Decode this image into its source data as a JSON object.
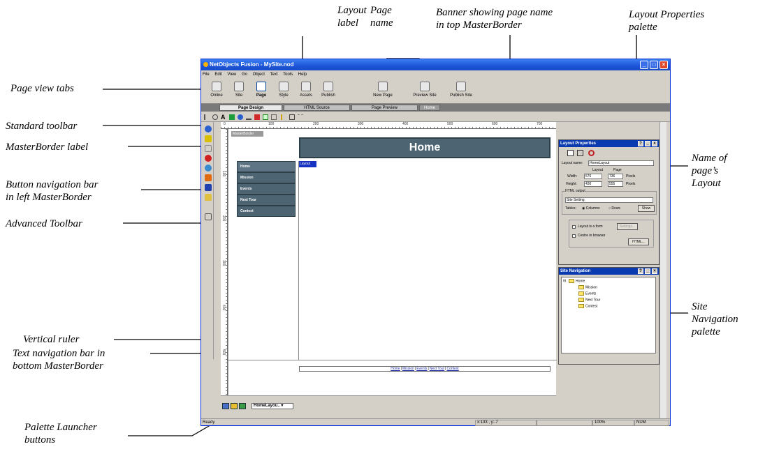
{
  "callouts": {
    "layout_label": "Layout\nlabel",
    "page_name": "Page\nname",
    "banner": "Banner showing page name\nin top MasterBorder",
    "layout_props": "Layout Properties\npalette",
    "page_view_tabs": "Page view tabs",
    "standard_toolbar": "Standard toolbar",
    "masterborder_label": "MasterBorder label",
    "button_nav": "Button navigation bar\nin left MasterBorder",
    "advanced_toolbar": "Advanced Toolbar",
    "layout_name": "Name of\npage’s\nLayout",
    "site_nav": "Site\nNavigation\npalette",
    "vertical_ruler": "Vertical ruler",
    "text_nav": "Text navigation bar in\nbottom MasterBorder",
    "palette_launcher": "Palette Launcher\nbuttons"
  },
  "window": {
    "title": "NetObjects Fusion - MySite.nod",
    "menu": [
      "File",
      "Edit",
      "View",
      "Go",
      "Object",
      "Text",
      "Tools",
      "Help"
    ],
    "toolbar_buttons": [
      "Online",
      "Site",
      "Page",
      "Style",
      "Assets",
      "Publish",
      "New Page",
      "Preview Site",
      "Publish Site"
    ],
    "selected_toolbar": "Page",
    "tabs": [
      "Page Design",
      "HTML Source",
      "Page Preview",
      "Home"
    ],
    "ruler_numbers": [
      "0",
      "100",
      "200",
      "300",
      "400",
      "500",
      "600",
      "700"
    ],
    "masterborder_label": "MasterBorder",
    "banner_text": "Home",
    "layout_label": "Layout",
    "nav_buttons": [
      "Home",
      "Mission",
      "Events",
      "Next Tour",
      "Contest"
    ],
    "text_nav": [
      "Home",
      "Mission",
      "Events",
      "Next Tour",
      "Contest"
    ],
    "layout_select": "HomeLayou..",
    "status": {
      "left": "Ready",
      "coords": "x:133 , y:-7",
      "zoom": "100%",
      "num": "NUM"
    }
  },
  "layout_props": {
    "title": "Layout Properties",
    "name_label": "Layout name:",
    "name_value": "HomeLayout",
    "col_layout": "Layout",
    "col_page": "Page",
    "width_label": "Width:",
    "height_label": "Height:",
    "width_layout": "576",
    "width_page": "736",
    "height_layout": "430",
    "height_page": "555",
    "unit": "Pixels",
    "html_output": "HTML output",
    "site_setting": "Site Setting",
    "tables_label": "Tables:",
    "columns": "Columns",
    "rows": "Rows",
    "show": "Show",
    "layout_form": "Layout is a form",
    "settings": "Settings...",
    "center": "Centre in browser",
    "html_btn": "HTML..."
  },
  "site_nav": {
    "title": "Site Navigation",
    "nodes": [
      "Home",
      "Mission",
      "Events",
      "Next Tour",
      "Contest"
    ]
  },
  "colors": {
    "banner": "#4d6472",
    "titlebar": "#1c54d8",
    "layout_label": "#1533c0"
  }
}
